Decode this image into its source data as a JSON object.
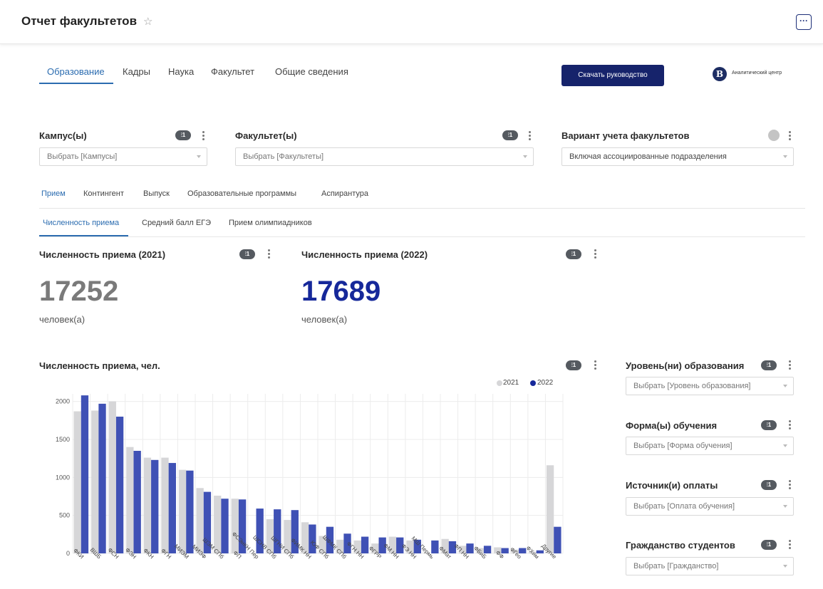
{
  "header": {
    "title": "Отчет факультетов",
    "star_icon": "star-icon",
    "more_label": "···"
  },
  "main_tabs": [
    {
      "label": "Образование",
      "active": true
    },
    {
      "label": "Кадры",
      "active": false
    },
    {
      "label": "Наука",
      "active": false
    },
    {
      "label": "Факультет",
      "active": false
    },
    {
      "label": "Общие сведения",
      "active": false
    }
  ],
  "download_button": "Скачать руководство",
  "brand": {
    "logo_letter": "В",
    "name": "Аналитический центр"
  },
  "filters": {
    "campus": {
      "label": "Кампус(ы)",
      "badge": "1",
      "placeholder": "Выбрать [Кампусы]"
    },
    "faculty": {
      "label": "Факультет(ы)",
      "badge": "1",
      "placeholder": "Выбрать [Факультеты]"
    },
    "variant": {
      "label": "Вариант учета факультетов",
      "value": "Включая ассоциированные подразделения"
    }
  },
  "section_tabs": [
    {
      "label": "Прием",
      "active": true
    },
    {
      "label": "Контингент",
      "active": false
    },
    {
      "label": "Выпуск",
      "active": false
    },
    {
      "label": "Образовательные программы",
      "active": false
    },
    {
      "label": "Аспирантура",
      "active": false
    }
  ],
  "sub_tabs": [
    {
      "label": "Численность приема",
      "active": true
    },
    {
      "label": "Средний балл ЕГЭ",
      "active": false
    },
    {
      "label": "Прием олимпиадников",
      "active": false
    }
  ],
  "kpis": [
    {
      "title": "Численность приема (2021)",
      "value": "17252",
      "unit": "человек(а)",
      "badge": "1",
      "color": "#7a7a7a"
    },
    {
      "title": "Численность приема (2022)",
      "value": "17689",
      "unit": "человек(а)",
      "badge": "1",
      "color": "#16289a"
    }
  ],
  "chart_title": "Численность приема, чел.",
  "chart_badge": "1",
  "right_filters": [
    {
      "label": "Уровень(ни) образования",
      "badge": "1",
      "placeholder": "Выбрать [Уровень образования]"
    },
    {
      "label": "Форма(ы) обучения",
      "badge": "1",
      "placeholder": "Выбрать [Форма обучения]"
    },
    {
      "label": "Источник(и) оплаты",
      "badge": "1",
      "placeholder": "Выбрать [Оплата обучения]"
    },
    {
      "label": "Гражданство студентов",
      "badge": "1",
      "placeholder": "Выбрать [Гражданство]"
    }
  ],
  "colors": {
    "accent": "#2b6cb0",
    "series_2021": "#d6d6d8",
    "series_2022": "#3f51b5",
    "button": "#16236b"
  },
  "chart_data": {
    "type": "bar",
    "title": "Численность приема, чел.",
    "categories": [
      "ФКИ",
      "ВШБ",
      "ФСН",
      "ФЭН",
      "ФКН",
      "ФГН",
      "МИЭМ",
      "МИЭФ",
      "ШЭМ СПб",
      "ФП",
      "ФСЭиКН Пер",
      "ШСНВ СПб",
      "ШГНИ СПб",
      "ФИМК НН",
      "ЮФ СПб",
      "ШФМК СПб",
      "ФГН НН",
      "ФГРР",
      "ФМ НН",
      "ФЭ НН",
      "МШ Пермь",
      "ФМат",
      "ФП НН",
      "ФБиБ",
      "ФФ",
      "ФГео",
      "ФХим",
      "Другие"
    ],
    "series": [
      {
        "name": "2021",
        "values": [
          1870,
          1880,
          2000,
          1400,
          1260,
          1260,
          1100,
          860,
          760,
          720,
          0,
          450,
          440,
          410,
          230,
          180,
          170,
          130,
          220,
          170,
          0,
          190,
          100,
          70,
          80,
          50,
          20,
          1160
        ]
      },
      {
        "name": "2022",
        "values": [
          2080,
          1970,
          1800,
          1350,
          1230,
          1190,
          1090,
          810,
          720,
          710,
          590,
          580,
          570,
          380,
          350,
          260,
          220,
          210,
          210,
          180,
          170,
          160,
          130,
          100,
          70,
          70,
          40,
          350
        ]
      }
    ],
    "ylim": [
      0,
      2100
    ],
    "yticks": [
      "0",
      "500",
      "1000",
      "1500",
      "2000"
    ],
    "legend": "top-right",
    "grid": true
  }
}
